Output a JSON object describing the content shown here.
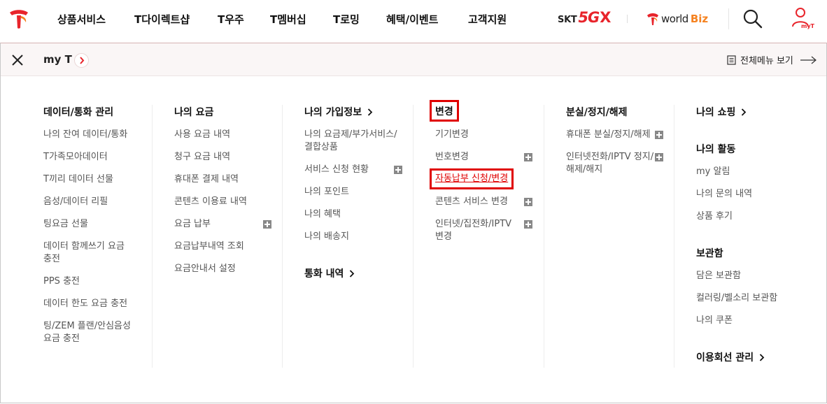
{
  "gnb": {
    "logo_icon": "sk-telecom-logo-icon",
    "menu": [
      "상품서비스",
      "T다이렉트샵",
      "T우주",
      "T멤버십",
      "T로밍",
      "혜택/이벤트",
      "고객지원"
    ],
    "brand_5gx": {
      "skt": "SKT",
      "five_g": "5G",
      "x": "X"
    },
    "worldbiz": {
      "world": "world",
      "biz": "Biz"
    },
    "myt_label": "myT"
  },
  "panel": {
    "title": "my T",
    "all_menu_label": "전체메뉴 보기",
    "columns": [
      {
        "heading": "데이터/통화 관리",
        "items": [
          "나의 잔여 데이터/통화",
          "T가족모아데이터",
          "T끼리 데이터 선물",
          "음성/데이터 리필",
          "팅요금 선물",
          "데이터 함께쓰기 요금",
          "충전",
          "PPS 충전",
          "데이터 한도 요금 충전",
          "팅/ZEM 플랜/안심음성",
          "요금 충전"
        ]
      },
      {
        "heading": "나의 요금",
        "items": [
          "사용 요금 내역",
          "청구 요금 내역",
          "휴대폰 결제 내역",
          "콘텐츠 이용료 내역",
          "요금 납부",
          "요금납부내역 조회",
          "요금안내서 설정"
        ]
      },
      {
        "heading": "나의 가입정보",
        "items": [
          "나의 요금제/부가서비스/",
          "결합상품",
          "서비스 신청 현황",
          "나의 포인트",
          "나의 혜택",
          "나의 배송지"
        ],
        "heading2": "통화 내역"
      },
      {
        "heading": "변경",
        "items": [
          "기기변경",
          "번호변경",
          "자동납부 신청/변경",
          "콘텐츠 서비스 변경",
          "인터넷/집전화/IPTV",
          "변경"
        ]
      },
      {
        "heading": "분실/정지/해제",
        "items": [
          "휴대폰 분실/정지/해제",
          "인터넷전화/IPTV 정지/",
          "해제/해지"
        ]
      },
      {
        "heading": "나의 쇼핑",
        "heading2": "나의 활동",
        "items2": [
          "my 알림",
          "나의 문의 내역",
          "상품 후기"
        ],
        "heading3": "보관함",
        "items3": [
          "담은 보관함",
          "컬러링/벨소리 보관함",
          "나의 쿠폰"
        ],
        "heading4": "이용회선 관리"
      }
    ]
  },
  "colors": {
    "accent_red": "#e8242b",
    "highlight_box": "#e00000",
    "biz_orange": "#f58220"
  }
}
